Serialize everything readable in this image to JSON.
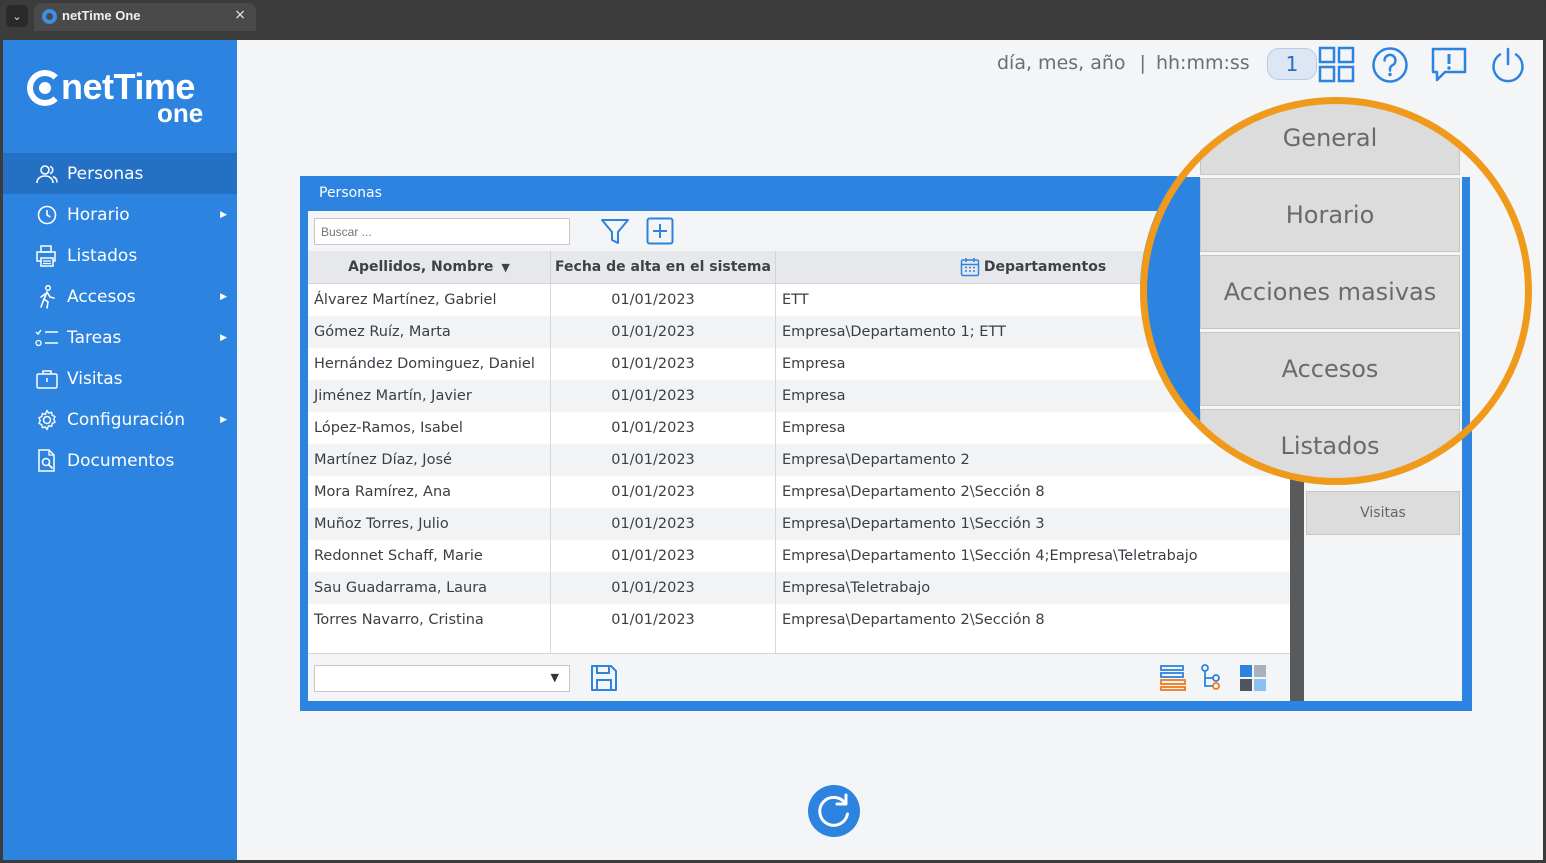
{
  "browser": {
    "tab_title": "netTime One",
    "close_glyph": "×",
    "menu_glyph": "⌄"
  },
  "logo": {
    "name": "netTime",
    "sub": "one"
  },
  "sidebar": {
    "items": [
      {
        "label": "Personas",
        "icon": "people-icon",
        "active": true,
        "has_submenu": false
      },
      {
        "label": "Horario",
        "icon": "clock-icon",
        "active": false,
        "has_submenu": true
      },
      {
        "label": "Listados",
        "icon": "printer-icon",
        "active": false,
        "has_submenu": false
      },
      {
        "label": "Accesos",
        "icon": "walking-person-icon",
        "active": false,
        "has_submenu": true
      },
      {
        "label": "Tareas",
        "icon": "checklist-icon",
        "active": false,
        "has_submenu": true
      },
      {
        "label": "Visitas",
        "icon": "briefcase-icon",
        "active": false,
        "has_submenu": false
      },
      {
        "label": "Configuración",
        "icon": "gear-icon",
        "active": false,
        "has_submenu": true
      },
      {
        "label": "Documentos",
        "icon": "document-search-icon",
        "active": false,
        "has_submenu": false
      }
    ],
    "arrow_glyph": "▶"
  },
  "header": {
    "date": "día, mes, año",
    "separator": "|",
    "time": "hh:mm:ss",
    "counter": "1",
    "icons": [
      "grid-icon",
      "help-icon",
      "alert-icon",
      "power-icon"
    ]
  },
  "panel": {
    "title": "Personas",
    "search_placeholder": "Buscar ...",
    "columns": [
      "Apellidos, Nombre",
      "Fecha de alta en el sistema",
      "Departamentos"
    ],
    "sort_glyph": "▼",
    "rows": [
      [
        "Álvarez Martínez, Gabriel",
        "01/01/2023",
        "ETT"
      ],
      [
        "Gómez Ruíz, Marta",
        "01/01/2023",
        "Empresa\\Departamento 1; ETT"
      ],
      [
        "Hernández Dominguez, Daniel",
        "01/01/2023",
        "Empresa"
      ],
      [
        "Jiménez Martín, Javier",
        "01/01/2023",
        "Empresa"
      ],
      [
        "López-Ramos, Isabel",
        "01/01/2023",
        "Empresa"
      ],
      [
        "Martínez Díaz, José",
        "01/01/2023",
        "Empresa\\Departamento 2"
      ],
      [
        "Mora Ramírez, Ana",
        "01/01/2023",
        "Empresa\\Departamento 2\\Sección 8"
      ],
      [
        "Muñoz Torres, Julio",
        "01/01/2023",
        "Empresa\\Departamento 1\\Sección 3"
      ],
      [
        "Redonnet Schaff, Marie",
        "01/01/2023",
        "Empresa\\Departamento 1\\Sección 4;Empresa\\Teletrabajo"
      ],
      [
        "Sau Guadarrama, Laura",
        "01/01/2023",
        "Empresa\\Teletrabajo"
      ],
      [
        "Torres Navarro, Cristina",
        "01/01/2023",
        "Empresa\\Departamento 2\\Sección 8"
      ]
    ],
    "select_arrow": "▼",
    "side_buttons": [
      "Visitas"
    ]
  },
  "magnifier": {
    "buttons": [
      "General",
      "Horario",
      "Acciones masivas",
      "Accesos",
      "Listados"
    ]
  },
  "colors": {
    "brand_blue": "#2d83e0",
    "highlight_orange": "#f09a1c"
  }
}
